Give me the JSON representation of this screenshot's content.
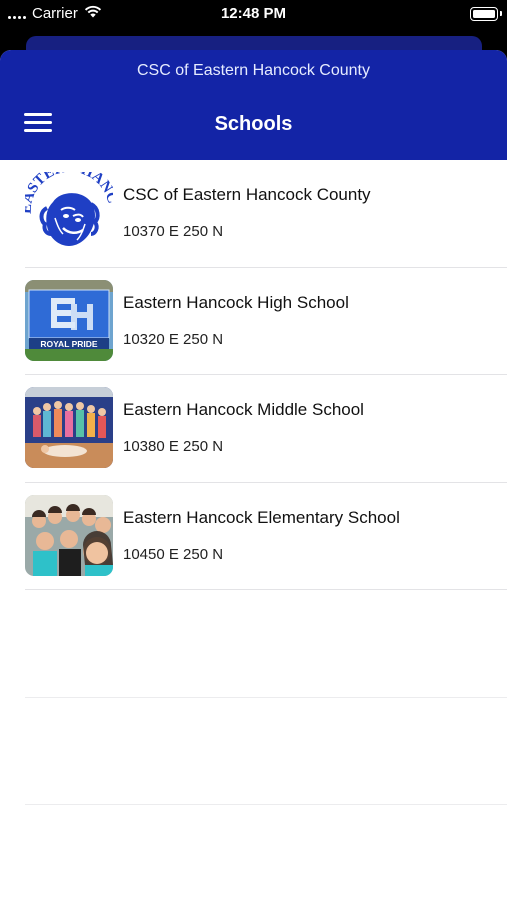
{
  "status_bar": {
    "carrier": "Carrier",
    "time": "12:48 PM"
  },
  "header": {
    "organization": "CSC of Eastern Hancock County",
    "title": "Schools",
    "menu_icon": "hamburger-menu-icon"
  },
  "schools": [
    {
      "name": "CSC of Eastern Hancock County",
      "address": "10370 E 250 N",
      "thumbnail": "eastern-hancock-lion-logo",
      "logo_text": "EASTERN HANCOCK"
    },
    {
      "name": "Eastern Hancock High School",
      "address": "10320 E 250 N",
      "thumbnail": "royal-pride-banner-photo",
      "banner_text": "ROYAL PRIDE"
    },
    {
      "name": "Eastern Hancock Middle School",
      "address": "10380 E 250 N",
      "thumbnail": "middle-school-group-photo"
    },
    {
      "name": "Eastern Hancock Elementary School",
      "address": "10450 E 250 N",
      "thumbnail": "elementary-selfie-photo"
    }
  ],
  "colors": {
    "header_bg": "#1324a6",
    "accent": "#1f3fc4"
  }
}
